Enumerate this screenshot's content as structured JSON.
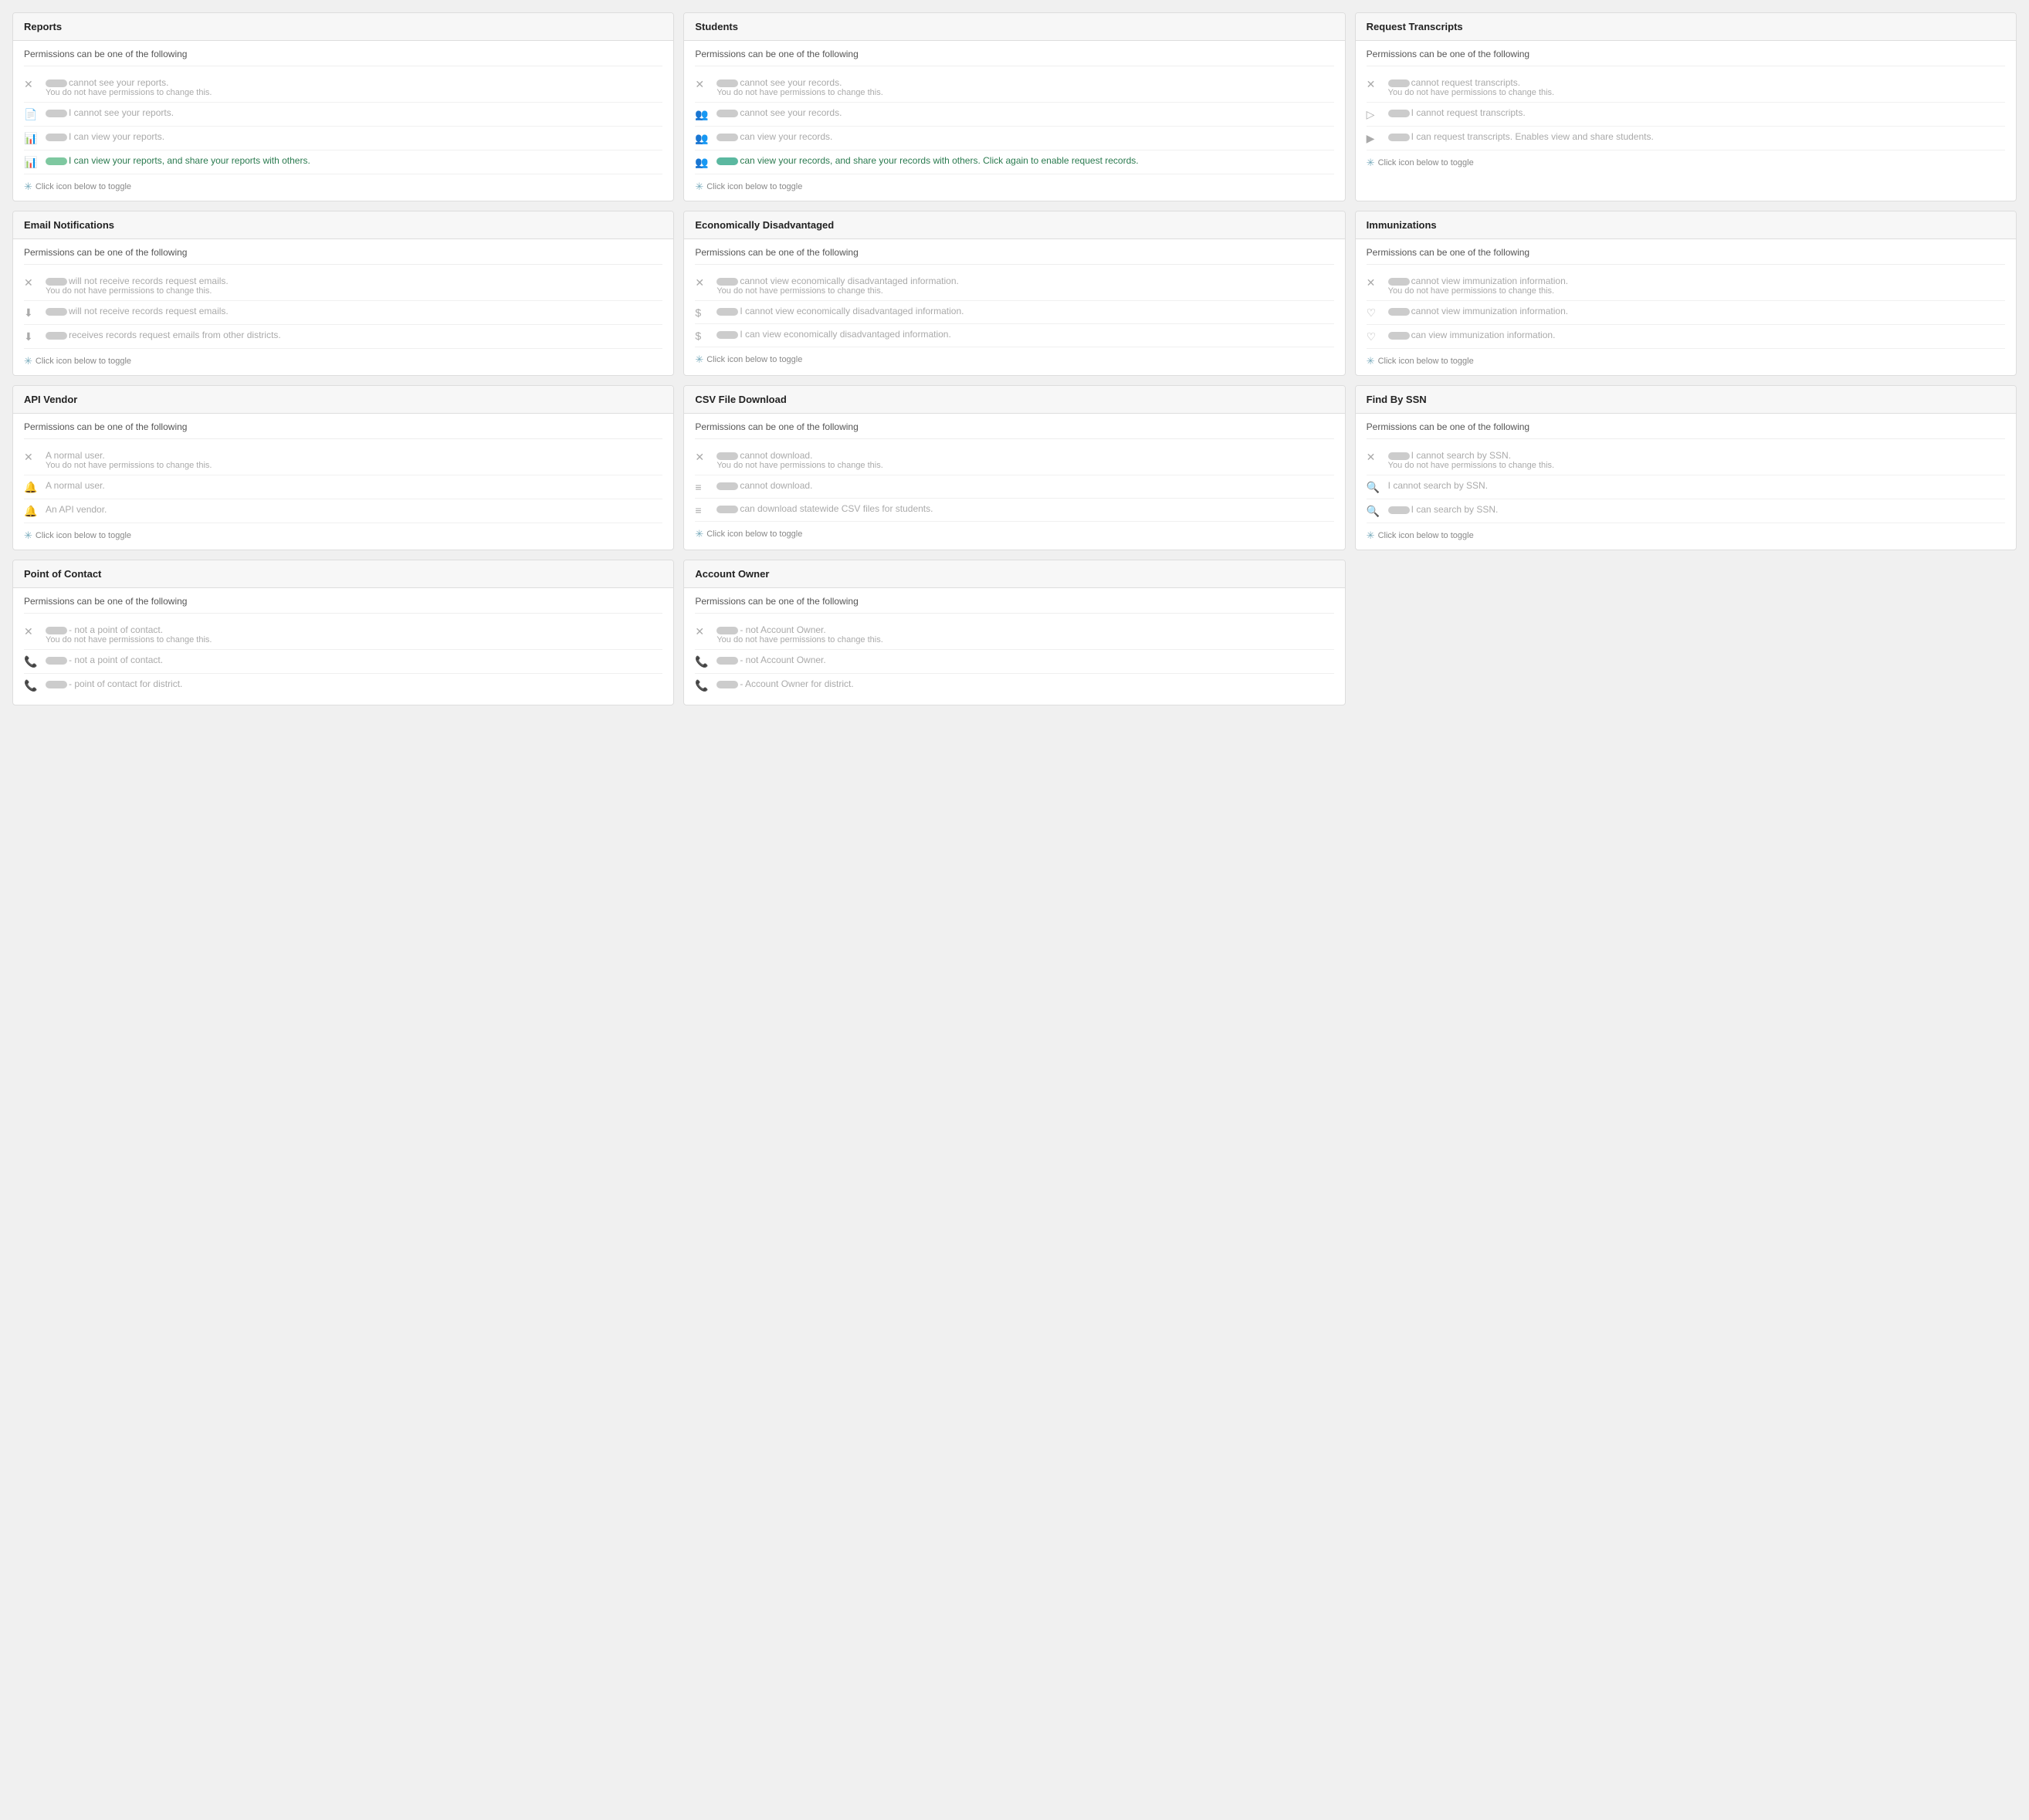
{
  "cards": [
    {
      "id": "reports",
      "title": "Reports",
      "subtitle": "Permissions can be one of the following",
      "permissions": [
        {
          "icon": "✕",
          "iconClass": "x-icon",
          "badge": true,
          "badgeColor": "",
          "text": "cannot see your reports.",
          "subtext": "You do not have permissions to change this.",
          "state": "disabled"
        },
        {
          "icon": "📄",
          "iconClass": "",
          "badge": true,
          "badgeColor": "",
          "text": "I cannot see your reports.",
          "subtext": "",
          "state": "disabled"
        },
        {
          "icon": "📊",
          "iconClass": "",
          "badge": true,
          "badgeColor": "",
          "text": "I can view your reports.",
          "subtext": "",
          "state": "disabled"
        },
        {
          "icon": "📊",
          "iconClass": "",
          "badge": true,
          "badgeColor": "green",
          "text": "I can view your reports, and share your reports with others.",
          "subtext": "",
          "state": "active"
        }
      ],
      "toggle": "Click icon below to toggle"
    },
    {
      "id": "students",
      "title": "Students",
      "subtitle": "Permissions can be one of the following",
      "permissions": [
        {
          "icon": "✕",
          "iconClass": "x-icon",
          "badge": true,
          "badgeColor": "",
          "text": "cannot see your records.",
          "subtext": "You do not have permissions to change this.",
          "state": "disabled"
        },
        {
          "icon": "👥",
          "iconClass": "",
          "badge": true,
          "badgeColor": "",
          "text": "cannot see your records.",
          "subtext": "",
          "state": "disabled"
        },
        {
          "icon": "👥",
          "iconClass": "",
          "badge": true,
          "badgeColor": "",
          "text": "can view your records.",
          "subtext": "",
          "state": "disabled"
        },
        {
          "icon": "👥",
          "iconClass": "",
          "badge": true,
          "badgeColor": "teal",
          "text": "can view your records, and share your records with others. Click again to enable request records.",
          "subtext": "",
          "state": "active"
        }
      ],
      "toggle": "Click icon below to toggle"
    },
    {
      "id": "request-transcripts",
      "title": "Request Transcripts",
      "subtitle": "Permissions can be one of the following",
      "permissions": [
        {
          "icon": "✕",
          "iconClass": "x-icon",
          "badge": true,
          "badgeColor": "",
          "text": "cannot request transcripts.",
          "subtext": "You do not have permissions to change this.",
          "state": "disabled"
        },
        {
          "icon": "▷",
          "iconClass": "",
          "badge": true,
          "badgeColor": "",
          "text": "I cannot request transcripts.",
          "subtext": "",
          "state": "disabled"
        },
        {
          "icon": "▶",
          "iconClass": "",
          "badge": true,
          "badgeColor": "",
          "text": "I can request transcripts. Enables view and share students.",
          "subtext": "",
          "state": "disabled"
        }
      ],
      "toggle": "Click icon below to toggle"
    },
    {
      "id": "email-notifications",
      "title": "Email Notifications",
      "subtitle": "Permissions can be one of the following",
      "permissions": [
        {
          "icon": "✕",
          "iconClass": "x-icon",
          "badge": true,
          "badgeColor": "",
          "text": "will not receive records request emails.",
          "subtext": "You do not have permissions to change this.",
          "state": "disabled"
        },
        {
          "icon": "⬇",
          "iconClass": "",
          "badge": true,
          "badgeColor": "",
          "text": "will not receive records request emails.",
          "subtext": "",
          "state": "disabled"
        },
        {
          "icon": "⬇",
          "iconClass": "",
          "badge": true,
          "badgeColor": "",
          "text": "receives records request emails from other districts.",
          "subtext": "",
          "state": "disabled"
        }
      ],
      "toggle": "Click icon below to toggle"
    },
    {
      "id": "economically-disadvantaged",
      "title": "Economically Disadvantaged",
      "subtitle": "Permissions can be one of the following",
      "permissions": [
        {
          "icon": "✕",
          "iconClass": "x-icon",
          "badge": true,
          "badgeColor": "",
          "text": "cannot view economically disadvantaged information.",
          "subtext": "You do not have permissions to change this.",
          "state": "disabled"
        },
        {
          "icon": "$",
          "iconClass": "",
          "badge": true,
          "badgeColor": "",
          "text": "I cannot view economically disadvantaged information.",
          "subtext": "",
          "state": "disabled"
        },
        {
          "icon": "$",
          "iconClass": "",
          "badge": true,
          "badgeColor": "",
          "text": "I can view economically disadvantaged information.",
          "subtext": "",
          "state": "disabled"
        }
      ],
      "toggle": "Click icon below to toggle"
    },
    {
      "id": "immunizations",
      "title": "Immunizations",
      "subtitle": "Permissions can be one of the following",
      "permissions": [
        {
          "icon": "✕",
          "iconClass": "x-icon",
          "badge": true,
          "badgeColor": "",
          "text": "cannot view immunization information.",
          "subtext": "You do not have permissions to change this.",
          "state": "disabled"
        },
        {
          "icon": "♡",
          "iconClass": "",
          "badge": true,
          "badgeColor": "",
          "text": "cannot view immunization information.",
          "subtext": "",
          "state": "disabled"
        },
        {
          "icon": "♡",
          "iconClass": "",
          "badge": true,
          "badgeColor": "",
          "text": "can view immunization information.",
          "subtext": "",
          "state": "disabled"
        }
      ],
      "toggle": "Click icon below to toggle"
    },
    {
      "id": "api-vendor",
      "title": "API Vendor",
      "subtitle": "Permissions can be one of the following",
      "permissions": [
        {
          "icon": "✕",
          "iconClass": "x-icon",
          "badge": false,
          "badgeColor": "",
          "text": "A normal user.",
          "subtext": "You do not have permissions to change this.",
          "state": "disabled"
        },
        {
          "icon": "🔔",
          "iconClass": "",
          "badge": false,
          "badgeColor": "",
          "text": "A normal user.",
          "subtext": "",
          "state": "disabled"
        },
        {
          "icon": "🔔",
          "iconClass": "",
          "badge": false,
          "badgeColor": "",
          "text": "An API vendor.",
          "subtext": "",
          "state": "disabled"
        }
      ],
      "toggle": "Click icon below to toggle"
    },
    {
      "id": "csv-file-download",
      "title": "CSV File Download",
      "subtitle": "Permissions can be one of the following",
      "permissions": [
        {
          "icon": "✕",
          "iconClass": "x-icon",
          "badge": true,
          "badgeColor": "",
          "text": "cannot download.",
          "subtext": "You do not have permissions to change this.",
          "state": "disabled"
        },
        {
          "icon": "≡",
          "iconClass": "",
          "badge": true,
          "badgeColor": "",
          "text": "cannot download.",
          "subtext": "",
          "state": "disabled"
        },
        {
          "icon": "≡",
          "iconClass": "",
          "badge": true,
          "badgeColor": "",
          "text": "can download statewide CSV files for students.",
          "subtext": "",
          "state": "disabled"
        }
      ],
      "toggle": "Click icon below to toggle"
    },
    {
      "id": "find-by-ssn",
      "title": "Find By SSN",
      "subtitle": "Permissions can be one of the following",
      "permissions": [
        {
          "icon": "✕",
          "iconClass": "x-icon",
          "badge": true,
          "badgeColor": "",
          "text": "I cannot search by SSN.",
          "subtext": "You do not have permissions to change this.",
          "state": "disabled"
        },
        {
          "icon": "🔍",
          "iconClass": "",
          "badge": false,
          "badgeColor": "",
          "text": "I cannot search by SSN.",
          "subtext": "",
          "state": "disabled"
        },
        {
          "icon": "🔍",
          "iconClass": "",
          "badge": true,
          "badgeColor": "",
          "text": "I can search by SSN.",
          "subtext": "",
          "state": "disabled"
        }
      ],
      "toggle": "Click icon below to toggle"
    },
    {
      "id": "point-of-contact",
      "title": "Point of Contact",
      "subtitle": "Permissions can be one of the following",
      "permissions": [
        {
          "icon": "✕",
          "iconClass": "x-icon",
          "badge": true,
          "badgeColor": "",
          "text": "- not a point of contact.",
          "subtext": "You do not have permissions to change this.",
          "state": "disabled"
        },
        {
          "icon": "📞",
          "iconClass": "",
          "badge": true,
          "badgeColor": "",
          "text": "- not a point of contact.",
          "subtext": "",
          "state": "disabled"
        },
        {
          "icon": "📞",
          "iconClass": "",
          "badge": true,
          "badgeColor": "",
          "text": "- point of contact for district.",
          "subtext": "",
          "state": "disabled"
        }
      ],
      "toggle": ""
    },
    {
      "id": "account-owner",
      "title": "Account Owner",
      "subtitle": "Permissions can be one of the following",
      "permissions": [
        {
          "icon": "✕",
          "iconClass": "x-icon",
          "badge": true,
          "badgeColor": "",
          "text": "- not Account Owner.",
          "subtext": "You do not have permissions to change this.",
          "state": "disabled"
        },
        {
          "icon": "📞",
          "iconClass": "",
          "badge": true,
          "badgeColor": "",
          "text": "- not Account Owner.",
          "subtext": "",
          "state": "disabled"
        },
        {
          "icon": "📞",
          "iconClass": "",
          "badge": true,
          "badgeColor": "",
          "text": "- Account Owner for district.",
          "subtext": "",
          "state": "disabled"
        }
      ],
      "toggle": ""
    }
  ]
}
